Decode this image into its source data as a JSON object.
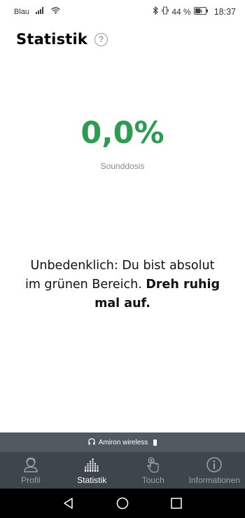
{
  "status_bar": {
    "carrier": "Blau",
    "battery_percent": "44 %",
    "time": "18:37"
  },
  "header": {
    "title": "Statistik",
    "help_glyph": "?"
  },
  "dose": {
    "value": "0,0%",
    "label": "Sounddosis",
    "color": "#2f9b52"
  },
  "message": {
    "regular": "Unbedenklich: Du bist absolut im grünen Bereich. ",
    "bold": "Dreh ruhig mal auf."
  },
  "device": {
    "name": "Amiron wireless"
  },
  "nav": {
    "items": [
      {
        "label": "Profil",
        "icon": "profile-icon",
        "active": false
      },
      {
        "label": "Statistik",
        "icon": "statistics-icon",
        "active": true
      },
      {
        "label": "Touch",
        "icon": "touch-icon",
        "active": false
      },
      {
        "label": "Informationen",
        "icon": "info-icon",
        "active": false
      }
    ]
  }
}
